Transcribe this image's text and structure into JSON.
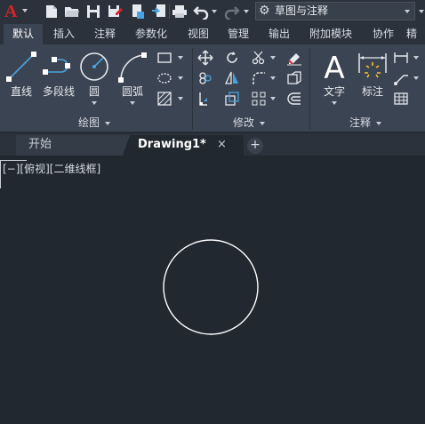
{
  "app": {
    "logo": "A"
  },
  "quick_access": {
    "workspace": "草图与注释",
    "icons": [
      "new-file-icon",
      "open-folder-icon",
      "save-icon",
      "save-as-icon",
      "publish-icon",
      "import-icon",
      "plot-icon",
      "undo-icon",
      "redo-icon"
    ]
  },
  "ribbon_tabs": [
    "默认",
    "插入",
    "注释",
    "参数化",
    "视图",
    "管理",
    "输出",
    "附加模块",
    "协作",
    "精"
  ],
  "active_tab": "默认",
  "panels": {
    "draw": {
      "title": "绘图",
      "buttons": {
        "line": "直线",
        "polyline": "多段线",
        "circle": "圆",
        "arc": "圆弧"
      }
    },
    "modify": {
      "title": "修改"
    },
    "annotation": {
      "title": "注释",
      "buttons": {
        "text": "文字",
        "dimension": "标注"
      }
    }
  },
  "file_tabs": {
    "start": "开始",
    "drawing": "Drawing1*",
    "close": "×",
    "new": "+"
  },
  "viewport": {
    "label": "[−][俯视][二维线框]"
  },
  "colors": {
    "accent": "#d8232a",
    "ribbon_bg": "#3b4452",
    "canvas_bg": "#212830",
    "icon_blue": "#4aa3df"
  }
}
